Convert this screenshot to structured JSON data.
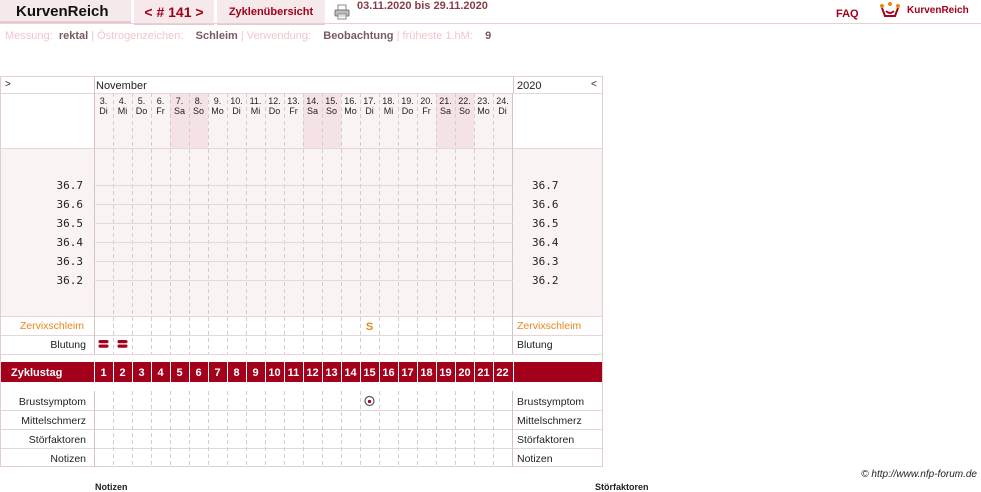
{
  "header": {
    "app_name": "KurvenReich",
    "prev_label": "<",
    "cycle_number": "# 141",
    "next_label": ">",
    "overview_label": "Zyklenübersicht",
    "date_range": "03.11.2020 bis 29.11.2020",
    "faq_label": "FAQ",
    "brand_label": "KurvenReich",
    "print_icon": "printer-icon",
    "logo_icon": "kurvenreich-logo-icon"
  },
  "info": {
    "messung_label": "Messung:",
    "messung_value": "rektal",
    "oestrogen_label": "Östrogenzeichen:",
    "oestrogen_value": "Schleim",
    "verwendung_label": "Verwendung:",
    "verwendung_value": "Beobachtung",
    "hm_label": "früheste 1.hM:",
    "hm_value": "9"
  },
  "chart": {
    "left_arrow": ">",
    "right_arrow": "<",
    "month": "November",
    "year": "2020",
    "days": [
      {
        "date": "3.",
        "wd": "Di",
        "weekend": false
      },
      {
        "date": "4.",
        "wd": "Mi",
        "weekend": false
      },
      {
        "date": "5.",
        "wd": "Do",
        "weekend": false
      },
      {
        "date": "6.",
        "wd": "Fr",
        "weekend": false
      },
      {
        "date": "7.",
        "wd": "Sa",
        "weekend": true
      },
      {
        "date": "8.",
        "wd": "So",
        "weekend": true
      },
      {
        "date": "9.",
        "wd": "Mo",
        "weekend": false
      },
      {
        "date": "10.",
        "wd": "Di",
        "weekend": false
      },
      {
        "date": "11.",
        "wd": "Mi",
        "weekend": false
      },
      {
        "date": "12.",
        "wd": "Do",
        "weekend": false
      },
      {
        "date": "13.",
        "wd": "Fr",
        "weekend": false
      },
      {
        "date": "14.",
        "wd": "Sa",
        "weekend": true
      },
      {
        "date": "15.",
        "wd": "So",
        "weekend": true
      },
      {
        "date": "16.",
        "wd": "Mo",
        "weekend": false
      },
      {
        "date": "17.",
        "wd": "Di",
        "weekend": false
      },
      {
        "date": "18.",
        "wd": "Mi",
        "weekend": false
      },
      {
        "date": "19.",
        "wd": "Do",
        "weekend": false
      },
      {
        "date": "20.",
        "wd": "Fr",
        "weekend": false
      },
      {
        "date": "21.",
        "wd": "Sa",
        "weekend": true
      },
      {
        "date": "22.",
        "wd": "So",
        "weekend": true
      },
      {
        "date": "23.",
        "wd": "Mo",
        "weekend": false
      },
      {
        "date": "24.",
        "wd": "Di",
        "weekend": false
      }
    ],
    "temperatures": [
      "36.7",
      "36.6",
      "36.5",
      "36.4",
      "36.3",
      "36.2"
    ],
    "rows": {
      "zervix_label": "Zervixschleim",
      "blutung_label": "Blutung",
      "zyklustag_label": "Zyklustag",
      "brust_label": "Brustsymptom",
      "mittel_label": "Mittelschmerz",
      "stoer_label": "Störfaktoren",
      "notizen_label": "Notizen"
    },
    "cycle_days": [
      "1",
      "2",
      "3",
      "4",
      "5",
      "6",
      "7",
      "8",
      "9",
      "10",
      "11",
      "12",
      "13",
      "14",
      "15",
      "16",
      "17",
      "18",
      "19",
      "20",
      "21",
      "22"
    ],
    "entries": {
      "zervix": [
        {
          "day_index": 14,
          "symbol": "S"
        }
      ],
      "blutung": [
        {
          "day_index": 0,
          "icon": "bleeding-icon"
        },
        {
          "day_index": 1,
          "icon": "bleeding-icon"
        }
      ],
      "brust": [
        {
          "day_index": 14,
          "icon": "breast-symptom-icon"
        }
      ]
    },
    "colors": {
      "accent": "#a3001b",
      "zervix": "#e8861a",
      "weekend_shade": "#f5e2e5",
      "panel_bg": "#f9f0f1"
    }
  },
  "footer": {
    "credit": "© http://www.nfp-forum.de",
    "bottom_left": "Notizen",
    "bottom_right": "Störfaktoren"
  }
}
